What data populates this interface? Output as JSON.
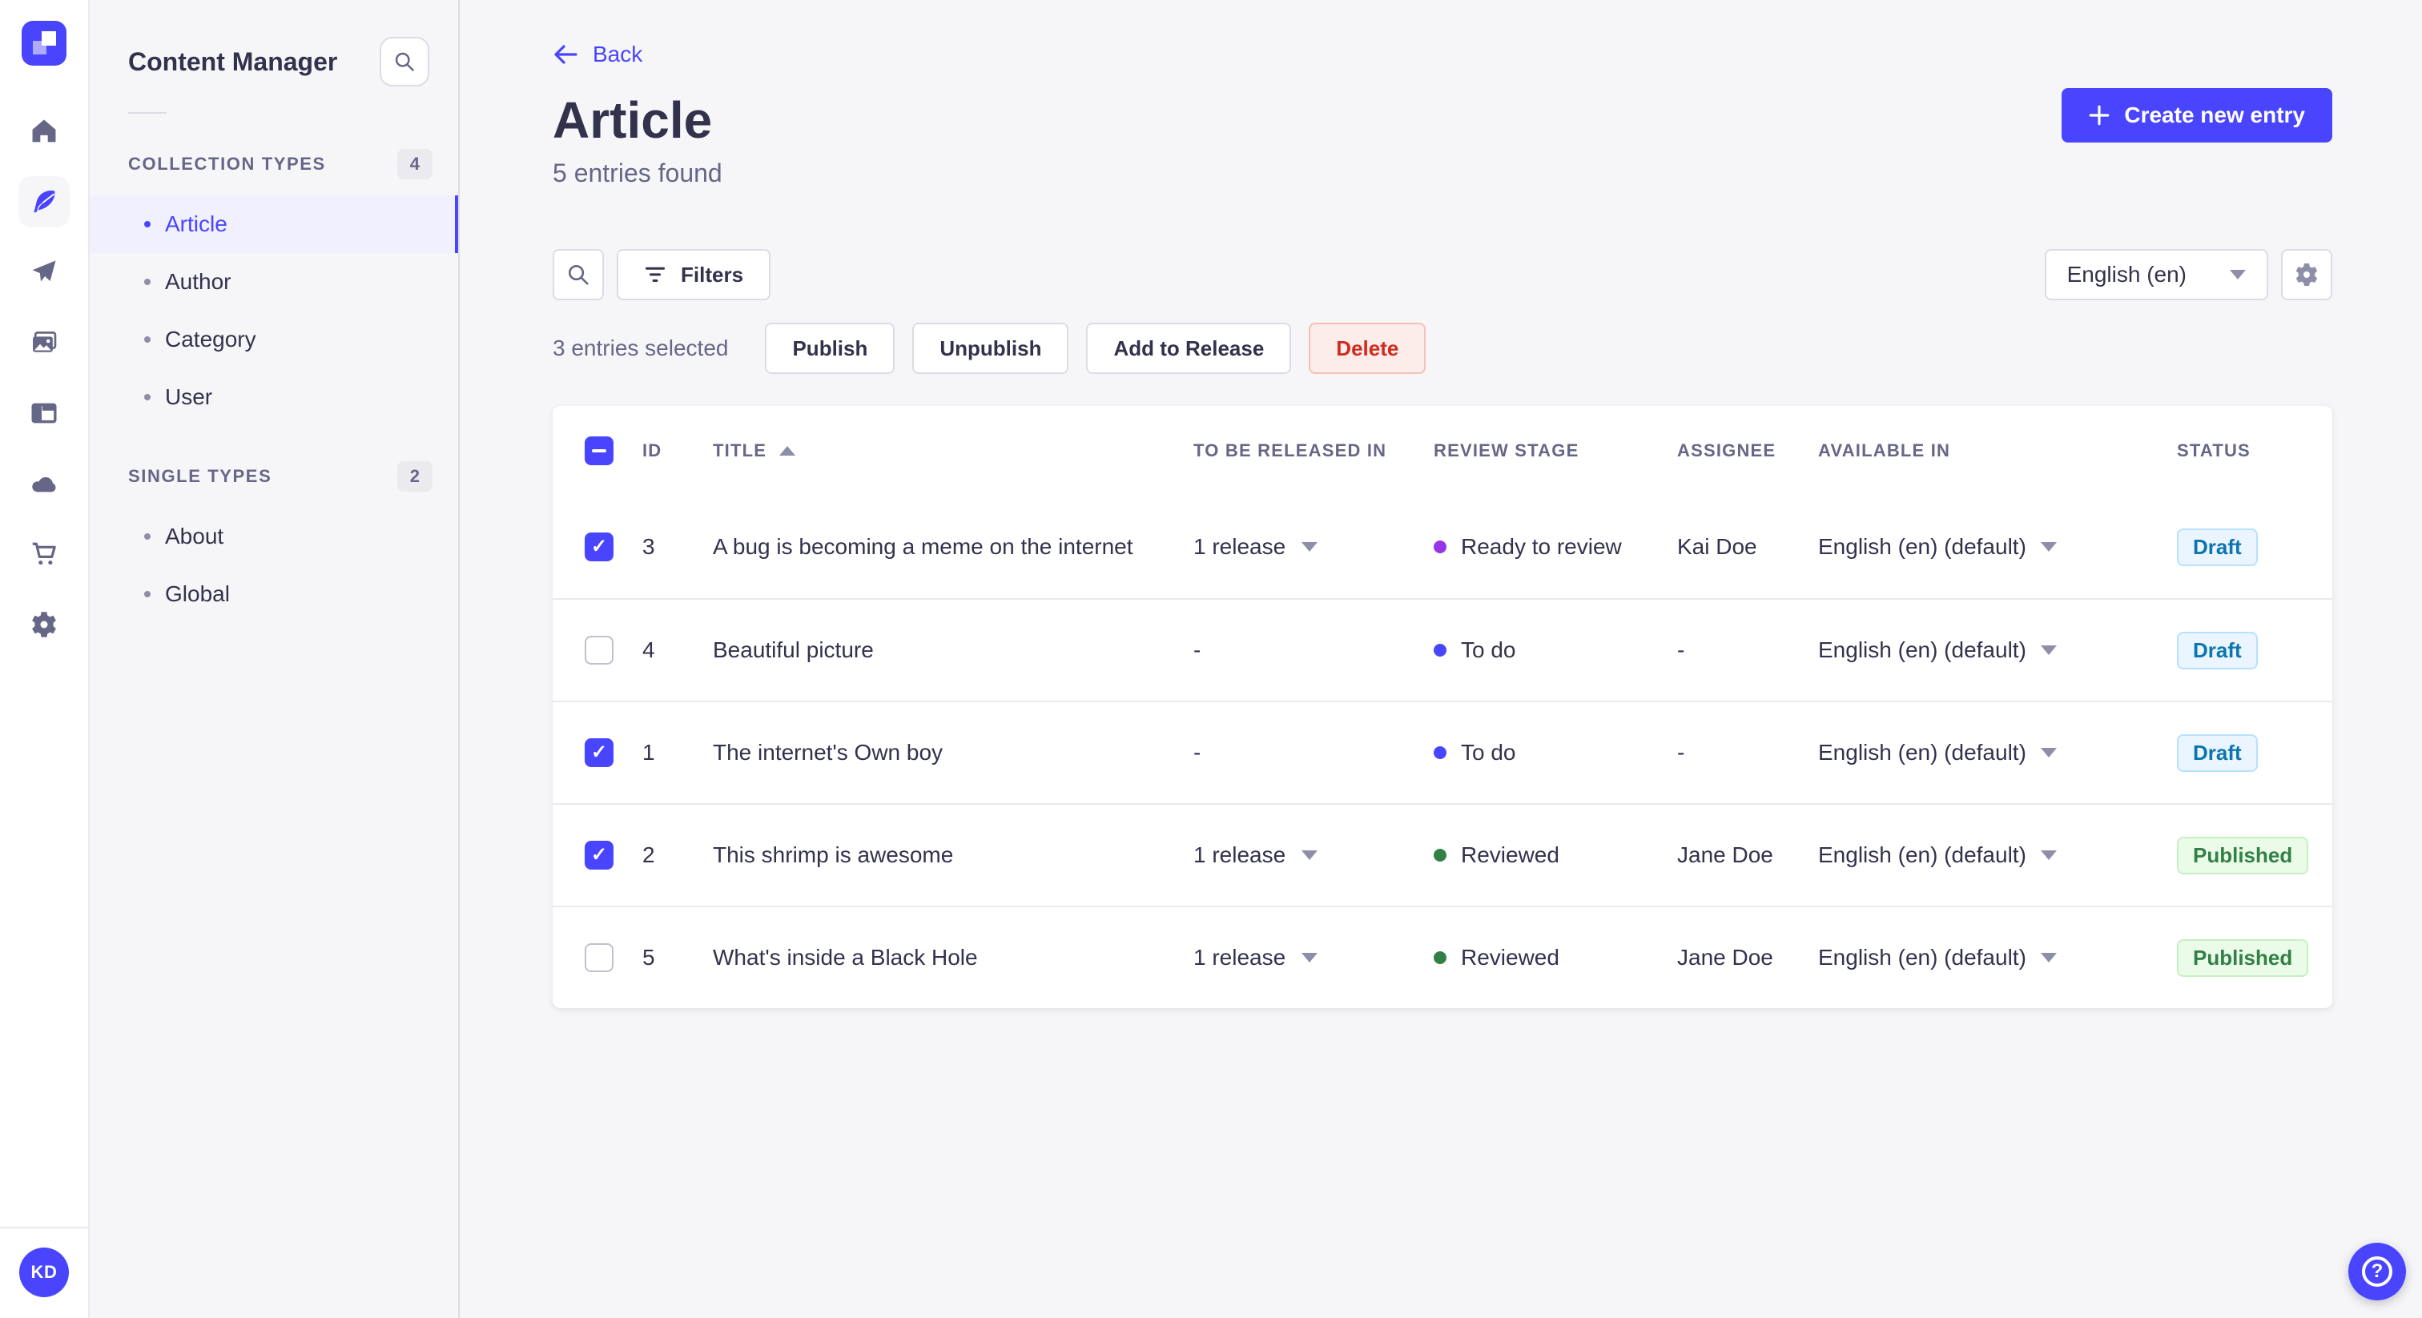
{
  "colors": {
    "primary": "#4945FF",
    "nav_icon": "#666687",
    "stage_ready_to_review": "#9736E8",
    "stage_to_do": "#4945FF",
    "stage_reviewed": "#328048",
    "draft_text": "#0C75AF",
    "draft_bg": "#EAF5FF",
    "published_text": "#328048",
    "published_bg": "#EAFBE7",
    "danger_text": "#D02B20",
    "danger_bg": "#FCECEA"
  },
  "nav": {
    "icons": [
      "strapi-logo",
      "home-icon",
      "content-manager-feather-icon",
      "paper-plane-icon",
      "media-library-icon",
      "layout-icon",
      "cloud-icon",
      "marketplace-cart-icon",
      "settings-gear-icon"
    ],
    "avatar_initials": "KD"
  },
  "subnav": {
    "title": "Content Manager",
    "sections": [
      {
        "label": "COLLECTION TYPES",
        "badge": "4",
        "items": [
          {
            "label": "Article",
            "active": true
          },
          {
            "label": "Author"
          },
          {
            "label": "Category"
          },
          {
            "label": "User"
          }
        ]
      },
      {
        "label": "SINGLE TYPES",
        "badge": "2",
        "items": [
          {
            "label": "About"
          },
          {
            "label": "Global"
          }
        ]
      }
    ]
  },
  "header": {
    "back": "Back",
    "title": "Article",
    "subtitle": "5 entries found",
    "create": "Create new entry"
  },
  "toolbar": {
    "filters": "Filters",
    "locale": "English (en)"
  },
  "selection": {
    "summary": "3 entries selected",
    "actions": [
      {
        "label": "Publish"
      },
      {
        "label": "Unpublish"
      },
      {
        "label": "Add to Release"
      },
      {
        "label": "Delete",
        "variant": "danger"
      }
    ]
  },
  "table": {
    "headers": {
      "id": "ID",
      "title": "TITLE",
      "release": "TO BE RELEASED IN",
      "stage": "REVIEW STAGE",
      "assignee": "ASSIGNEE",
      "available": "AVAILABLE IN",
      "status": "STATUS"
    },
    "rows": [
      {
        "checked": true,
        "id": "3",
        "title": "A bug is becoming a meme on the internet",
        "release": "1 release",
        "stage": "Ready to review",
        "stage_color": "purple",
        "assignee": "Kai Doe",
        "locale": "English (en) (default)",
        "status": "Draft",
        "status_variant": "draft"
      },
      {
        "checked": false,
        "id": "4",
        "title": "Beautiful picture",
        "release": "-",
        "stage": "To do",
        "stage_color": "blue",
        "assignee": "-",
        "locale": "English (en) (default)",
        "status": "Draft",
        "status_variant": "draft"
      },
      {
        "checked": true,
        "id": "1",
        "title": "The internet's Own boy",
        "release": "-",
        "stage": "To do",
        "stage_color": "blue",
        "assignee": "-",
        "locale": "English (en) (default)",
        "status": "Draft",
        "status_variant": "draft"
      },
      {
        "checked": true,
        "id": "2",
        "title": "This shrimp is awesome",
        "release": "1 release",
        "stage": "Reviewed",
        "stage_color": "green",
        "assignee": "Jane Doe",
        "locale": "English (en) (default)",
        "status": "Published",
        "status_variant": "published"
      },
      {
        "checked": false,
        "id": "5",
        "title": "What's inside a Black Hole",
        "release": "1 release",
        "stage": "Reviewed",
        "stage_color": "green",
        "assignee": "Jane Doe",
        "locale": "English (en) (default)",
        "status": "Published",
        "status_variant": "published"
      }
    ]
  },
  "fab": {
    "help": "?"
  }
}
